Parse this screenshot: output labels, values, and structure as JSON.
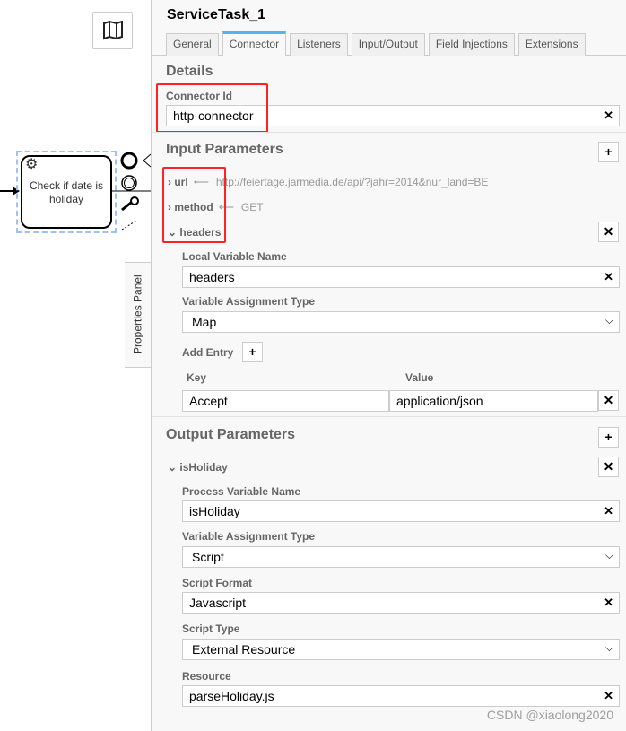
{
  "canvas": {
    "task_label": "Check if date is holiday",
    "properties_tab": "Properties Panel"
  },
  "panel": {
    "title": "ServiceTask_1",
    "tabs": [
      "General",
      "Connector",
      "Listeners",
      "Input/Output",
      "Field Injections",
      "Extensions"
    ],
    "active_tab": "Connector",
    "details": {
      "heading": "Details",
      "connector_id_label": "Connector Id",
      "connector_id": "http-connector"
    },
    "input": {
      "heading": "Input Parameters",
      "params": [
        {
          "name": "url",
          "value": "http://feiertage.jarmedia.de/api/?jahr=2014&nur_land=BE"
        },
        {
          "name": "method",
          "value": "GET"
        },
        {
          "name": "headers"
        }
      ],
      "local_var_label": "Local Variable Name",
      "local_var": "headers",
      "assign_type_label": "Variable Assignment Type",
      "assign_type": "Map",
      "add_entry": "Add Entry",
      "key_label": "Key",
      "value_label": "Value",
      "entry_key": "Accept",
      "entry_value": "application/json"
    },
    "output": {
      "heading": "Output Parameters",
      "param": "isHoliday",
      "proc_var_label": "Process Variable Name",
      "proc_var": "isHoliday",
      "assign_type_label": "Variable Assignment Type",
      "assign_type": "Script",
      "script_format_label": "Script Format",
      "script_format": "Javascript",
      "script_type_label": "Script Type",
      "script_type": "External Resource",
      "resource_label": "Resource",
      "resource": "parseHoliday.js"
    }
  },
  "watermark": "CSDN @xiaolong2020",
  "colors": {
    "highlight": "#ff2222",
    "active_tab": "#52b4ee"
  }
}
